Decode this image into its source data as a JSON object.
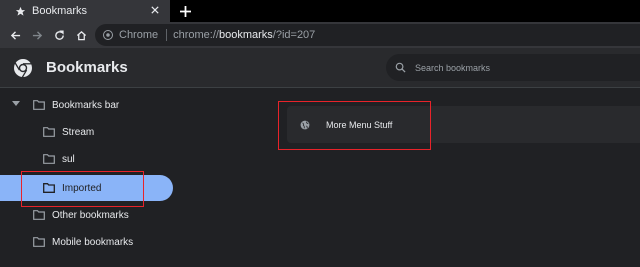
{
  "tab": {
    "title": "Bookmarks"
  },
  "toolbar": {
    "site_chip": "Chrome",
    "url_prefix": "chrome://",
    "url_host": "bookmarks",
    "url_path": "/?id=207"
  },
  "header": {
    "title": "Bookmarks",
    "search_placeholder": "Search bookmarks"
  },
  "sidebar": {
    "items": [
      {
        "label": "Bookmarks bar"
      },
      {
        "label": "Stream"
      },
      {
        "label": "sul"
      },
      {
        "label": "Imported"
      },
      {
        "label": "Other bookmarks"
      },
      {
        "label": "Mobile bookmarks"
      }
    ]
  },
  "main": {
    "bookmarks": [
      {
        "title": "More Menu Stuff"
      }
    ]
  },
  "colors": {
    "selected": "#8ab4f8",
    "highlight": "#e8232a",
    "background": "#202124"
  }
}
